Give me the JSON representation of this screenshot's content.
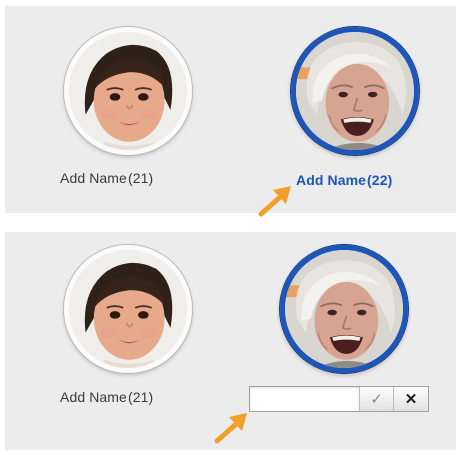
{
  "panels": [
    {
      "faces": [
        {
          "label": "Add Name",
          "count": "(21)",
          "state": "normal"
        },
        {
          "label": "Add Name",
          "count": "(22)",
          "state": "hover"
        }
      ]
    },
    {
      "faces": [
        {
          "label": "Add Name",
          "count": "(21)",
          "state": "normal"
        },
        {
          "label": "",
          "count": "",
          "state": "editing"
        }
      ],
      "editor": {
        "value": "",
        "placeholder": "",
        "confirm_glyph": "✓",
        "cancel_glyph": "✕"
      }
    }
  ],
  "colors": {
    "selection_ring": "#1d55b8",
    "label_selected": "#1d55b8",
    "label_normal": "#3a3a3a",
    "arrow": "#f0a028",
    "panel_bg": "#ececec"
  },
  "icons": [
    "child-face",
    "elder-face",
    "pointer-arrow",
    "checkmark-icon",
    "close-icon"
  ]
}
